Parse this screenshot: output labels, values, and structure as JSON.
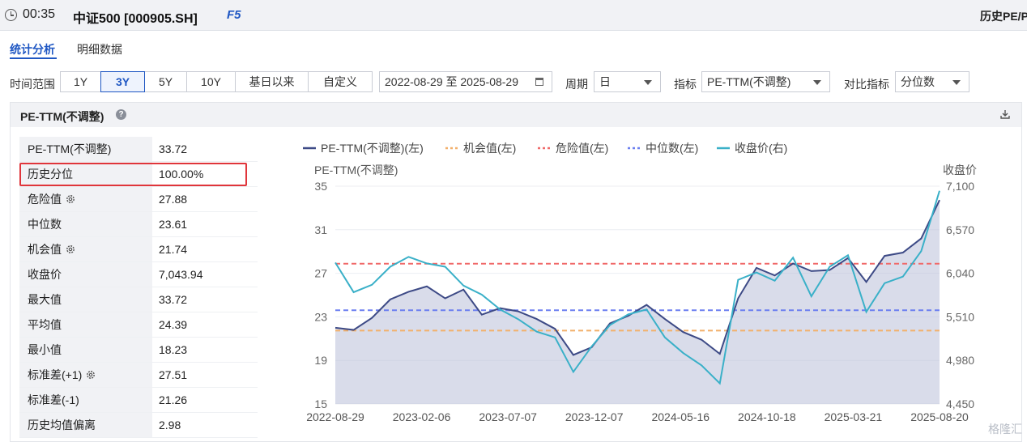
{
  "header": {
    "time": "00:35",
    "title": "中证500 [000905.SH]",
    "f5_label": "F5",
    "right_title": "历史PE/P"
  },
  "tabs": [
    {
      "label": "统计分析",
      "active": true
    },
    {
      "label": "明细数据",
      "active": false
    }
  ],
  "controls": {
    "range_label": "时间范围",
    "range_options": [
      "1Y",
      "3Y",
      "5Y",
      "10Y",
      "基日以来",
      "自定义"
    ],
    "range_selected": "3Y",
    "date_range": "2022-08-29 至 2025-08-29",
    "period_label": "周期",
    "period_value": "日",
    "indicator_label": "指标",
    "indicator_value": "PE-TTM(不调整)",
    "compare_label": "对比指标",
    "compare_value": "分位数"
  },
  "panel": {
    "title": "PE-TTM(不调整)",
    "help": "?"
  },
  "stats": [
    {
      "key": "PE-TTM(不调整)",
      "value": "33.72",
      "gear": false
    },
    {
      "key": "历史分位",
      "value": "100.00%",
      "gear": false
    },
    {
      "key": "危险值",
      "value": "27.88",
      "gear": true
    },
    {
      "key": "中位数",
      "value": "23.61",
      "gear": false
    },
    {
      "key": "机会值",
      "value": "21.74",
      "gear": true
    },
    {
      "key": "收盘价",
      "value": "7,043.94",
      "gear": false
    },
    {
      "key": "最大值",
      "value": "33.72",
      "gear": false
    },
    {
      "key": "平均值",
      "value": "24.39",
      "gear": false
    },
    {
      "key": "最小值",
      "value": "18.23",
      "gear": false
    },
    {
      "key": "标准差(+1)",
      "value": "27.51",
      "gear": true
    },
    {
      "key": "标准差(-1)",
      "value": "21.26",
      "gear": false
    },
    {
      "key": "历史均值偏离",
      "value": "2.98",
      "gear": false
    }
  ],
  "colors": {
    "accent": "#1f57c3",
    "pe": "#3d4a86",
    "pe_fill": "#b9bfd8",
    "opportunity": "#f2b06b",
    "danger": "#f06a6a",
    "median": "#6b7ff0",
    "close": "#3ab0c8",
    "highlight": "#e0353b"
  },
  "watermark": "格隆汇",
  "chart_data": {
    "type": "line",
    "title": "",
    "ylabel_left": "PE-TTM(不调整)",
    "ylabel_right": "收盘价",
    "ylim_left": [
      15,
      35
    ],
    "ylim_right": [
      4450,
      7100
    ],
    "yticks_left": [
      "35",
      "31",
      "27",
      "23",
      "19",
      "15"
    ],
    "yticks_right": [
      "7,100",
      "6,570",
      "6,040",
      "5,510",
      "4,980",
      "4,450"
    ],
    "xticks": [
      "2022-08-29",
      "2023-02-06",
      "2023-07-07",
      "2023-12-07",
      "2024-05-16",
      "2024-10-18",
      "2025-03-21",
      "2025-08-20"
    ],
    "legend": [
      "PE-TTM(不调整)(左)",
      "机会值(左)",
      "危险值(左)",
      "中位数(左)",
      "收盘价(右)"
    ],
    "legend_position": "top",
    "reference_lines": {
      "danger": 27.88,
      "median": 23.61,
      "opportunity": 21.74
    },
    "x": [
      "2022-08-29",
      "2022-10-10",
      "2022-11-20",
      "2023-01-01",
      "2023-02-06",
      "2023-03-15",
      "2023-04-20",
      "2023-05-25",
      "2023-07-07",
      "2023-08-15",
      "2023-09-20",
      "2023-10-25",
      "2023-12-07",
      "2024-01-20",
      "2024-02-08",
      "2024-03-15",
      "2024-04-20",
      "2024-05-16",
      "2024-06-20",
      "2024-07-25",
      "2024-08-30",
      "2024-09-20",
      "2024-10-01",
      "2024-10-18",
      "2024-11-20",
      "2024-12-25",
      "2025-01-20",
      "2025-02-20",
      "2025-03-21",
      "2025-04-08",
      "2025-05-15",
      "2025-06-20",
      "2025-07-20",
      "2025-08-20"
    ],
    "series": [
      {
        "name": "PE-TTM(不调整)(左)",
        "axis": "left",
        "values": [
          22.0,
          21.8,
          22.9,
          24.6,
          25.3,
          25.8,
          24.7,
          25.5,
          23.2,
          23.8,
          23.5,
          22.8,
          21.9,
          19.5,
          20.2,
          22.4,
          23.1,
          24.1,
          22.8,
          21.6,
          20.9,
          19.6,
          24.7,
          27.5,
          26.8,
          27.9,
          27.2,
          27.3,
          28.4,
          26.2,
          28.6,
          28.9,
          30.2,
          33.72
        ]
      },
      {
        "name": "收盘价(右)",
        "axis": "right",
        "values": [
          6170,
          5810,
          5900,
          6120,
          6240,
          6160,
          6120,
          5890,
          5780,
          5600,
          5480,
          5330,
          5260,
          4840,
          5150,
          5410,
          5540,
          5600,
          5260,
          5070,
          4920,
          4700,
          5960,
          6050,
          5950,
          6230,
          5760,
          6120,
          6260,
          5570,
          5920,
          6000,
          6310,
          7043.94
        ]
      }
    ]
  }
}
